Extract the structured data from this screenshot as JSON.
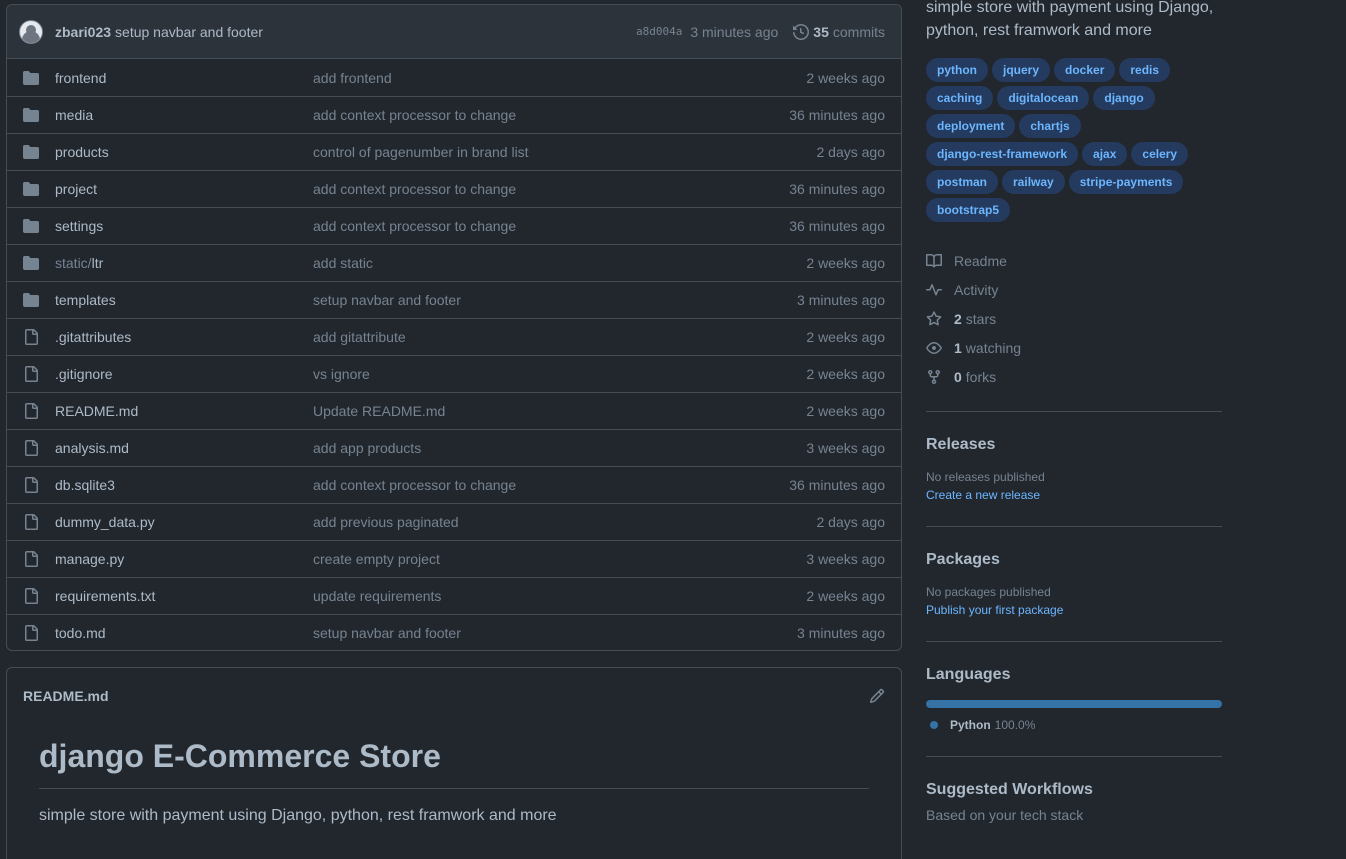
{
  "commit": {
    "author": "zbari023",
    "message": "setup navbar and footer",
    "sha": "a8d004a",
    "time": "3 minutes ago",
    "commit_count": "35",
    "commits_label": "commits"
  },
  "files": [
    {
      "type": "dir",
      "name": "frontend",
      "msg": "add frontend",
      "age": "2 weeks ago"
    },
    {
      "type": "dir",
      "name": "media",
      "msg": "add context processor to change",
      "age": "36 minutes ago"
    },
    {
      "type": "dir",
      "name": "products",
      "msg": "control of pagenumber in brand list",
      "age": "2 days ago"
    },
    {
      "type": "dir",
      "name": "project",
      "msg": "add context processor to change",
      "age": "36 minutes ago"
    },
    {
      "type": "dir",
      "name": "settings",
      "msg": "add context processor to change",
      "age": "36 minutes ago"
    },
    {
      "type": "dir",
      "name_dim": "static/",
      "name": "ltr",
      "msg": "add static",
      "age": "2 weeks ago"
    },
    {
      "type": "dir",
      "name": "templates",
      "msg": "setup navbar and footer",
      "age": "3 minutes ago"
    },
    {
      "type": "file",
      "name": ".gitattributes",
      "msg": "add gitattribute",
      "age": "2 weeks ago"
    },
    {
      "type": "file",
      "name": ".gitignore",
      "msg": "vs ignore",
      "age": "2 weeks ago"
    },
    {
      "type": "file",
      "name": "README.md",
      "msg": "Update README.md",
      "age": "2 weeks ago"
    },
    {
      "type": "file",
      "name": "analysis.md",
      "msg": "add app products",
      "age": "3 weeks ago"
    },
    {
      "type": "file",
      "name": "db.sqlite3",
      "msg": "add context processor to change",
      "age": "36 minutes ago"
    },
    {
      "type": "file",
      "name": "dummy_data.py",
      "msg": "add previous paginated",
      "age": "2 days ago"
    },
    {
      "type": "file",
      "name": "manage.py",
      "msg": "create empty project",
      "age": "3 weeks ago"
    },
    {
      "type": "file",
      "name": "requirements.txt",
      "msg": "update requirements",
      "age": "2 weeks ago"
    },
    {
      "type": "file",
      "name": "todo.md",
      "msg": "setup navbar and footer",
      "age": "3 minutes ago"
    }
  ],
  "readme": {
    "label": "README.md",
    "title": "django E-Commerce Store",
    "text": "simple store with payment using Django, python, rest framwork and more"
  },
  "sidebar": {
    "about": "simple store with payment using Django, python, rest framwork and more",
    "topics": [
      "python",
      "jquery",
      "docker",
      "redis",
      "caching",
      "digitalocean",
      "django",
      "deployment",
      "chartjs",
      "django-rest-framework",
      "ajax",
      "celery",
      "postman",
      "railway",
      "stripe-payments",
      "bootstrap5"
    ],
    "readme_label": "Readme",
    "activity_label": "Activity",
    "stars_count": "2",
    "stars_label": "stars",
    "watching_count": "1",
    "watching_label": "watching",
    "forks_count": "0",
    "forks_label": "forks",
    "releases": {
      "title": "Releases",
      "empty": "No releases published",
      "link": "Create a new release"
    },
    "packages": {
      "title": "Packages",
      "empty": "No packages published",
      "link": "Publish your first package"
    },
    "languages": {
      "title": "Languages",
      "items": [
        {
          "name": "Python",
          "pct": "100.0%",
          "color": "#3572a5"
        }
      ]
    },
    "workflows": {
      "title": "Suggested Workflows",
      "subtitle": "Based on your tech stack"
    }
  }
}
